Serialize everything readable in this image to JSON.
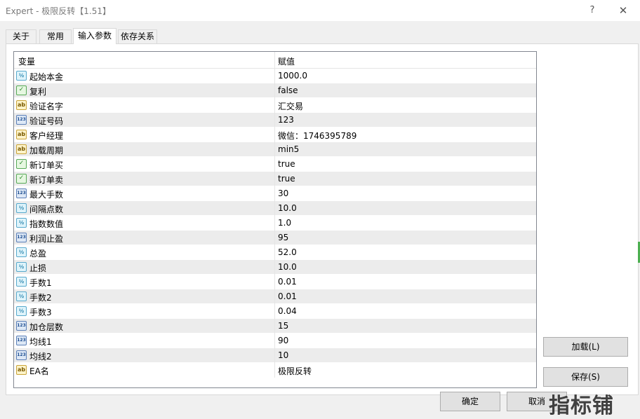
{
  "window": {
    "title": "Expert - 极限反转【1.51】",
    "help_label": "?",
    "close_label": "✕"
  },
  "tabs": [
    {
      "label": "关于"
    },
    {
      "label": "常用"
    },
    {
      "label": "输入参数",
      "active": true
    },
    {
      "label": "依存关系"
    }
  ],
  "grid": {
    "headers": {
      "variable": "变量",
      "value": "赋值"
    },
    "rows": [
      {
        "type": "double",
        "icon": "double-type-icon",
        "badge": "½",
        "name": "起始本金",
        "value": "1000.0"
      },
      {
        "type": "bool",
        "icon": "bool-type-icon",
        "badge": "✓",
        "name": "复利",
        "value": "false"
      },
      {
        "type": "string",
        "icon": "string-type-icon",
        "badge": "ab",
        "name": "验证名字",
        "value": "汇交易"
      },
      {
        "type": "int",
        "icon": "int-type-icon",
        "badge": "123",
        "name": "验证号码",
        "value": "123"
      },
      {
        "type": "string",
        "icon": "string-type-icon",
        "badge": "ab",
        "name": "客户经理",
        "value": "微信：1746395789"
      },
      {
        "type": "string",
        "icon": "string-type-icon",
        "badge": "ab",
        "name": "加载周期",
        "value": "min5"
      },
      {
        "type": "bool",
        "icon": "bool-type-icon",
        "badge": "✓",
        "name": "新订单买",
        "value": "true"
      },
      {
        "type": "bool",
        "icon": "bool-type-icon",
        "badge": "✓",
        "name": "新订单卖",
        "value": "true"
      },
      {
        "type": "int",
        "icon": "int-type-icon",
        "badge": "123",
        "name": "最大手数",
        "value": "30"
      },
      {
        "type": "double",
        "icon": "double-type-icon",
        "badge": "½",
        "name": "间隔点数",
        "value": "10.0"
      },
      {
        "type": "double",
        "icon": "double-type-icon",
        "badge": "½",
        "name": "指数数值",
        "value": "1.0"
      },
      {
        "type": "int",
        "icon": "int-type-icon",
        "badge": "123",
        "name": "利润止盈",
        "value": "95"
      },
      {
        "type": "double",
        "icon": "double-type-icon",
        "badge": "½",
        "name": "总盈",
        "value": "52.0"
      },
      {
        "type": "double",
        "icon": "double-type-icon",
        "badge": "½",
        "name": "止损",
        "value": "10.0"
      },
      {
        "type": "double",
        "icon": "double-type-icon",
        "badge": "½",
        "name": "手数1",
        "value": "0.01"
      },
      {
        "type": "double",
        "icon": "double-type-icon",
        "badge": "½",
        "name": "手数2",
        "value": "0.01"
      },
      {
        "type": "double",
        "icon": "double-type-icon",
        "badge": "½",
        "name": "手数3",
        "value": "0.04"
      },
      {
        "type": "int",
        "icon": "int-type-icon",
        "badge": "123",
        "name": "加仓层数",
        "value": "15"
      },
      {
        "type": "int",
        "icon": "int-type-icon",
        "badge": "123",
        "name": "均线1",
        "value": "90"
      },
      {
        "type": "int",
        "icon": "int-type-icon",
        "badge": "123",
        "name": "均线2",
        "value": "10"
      },
      {
        "type": "string",
        "icon": "string-type-icon",
        "badge": "ab",
        "name": "EA名",
        "value": "极限反转"
      }
    ]
  },
  "buttons": {
    "load": "加载(L)",
    "save": "保存(S)",
    "ok": "确定",
    "cancel": "取消"
  },
  "watermark": "指标铺"
}
